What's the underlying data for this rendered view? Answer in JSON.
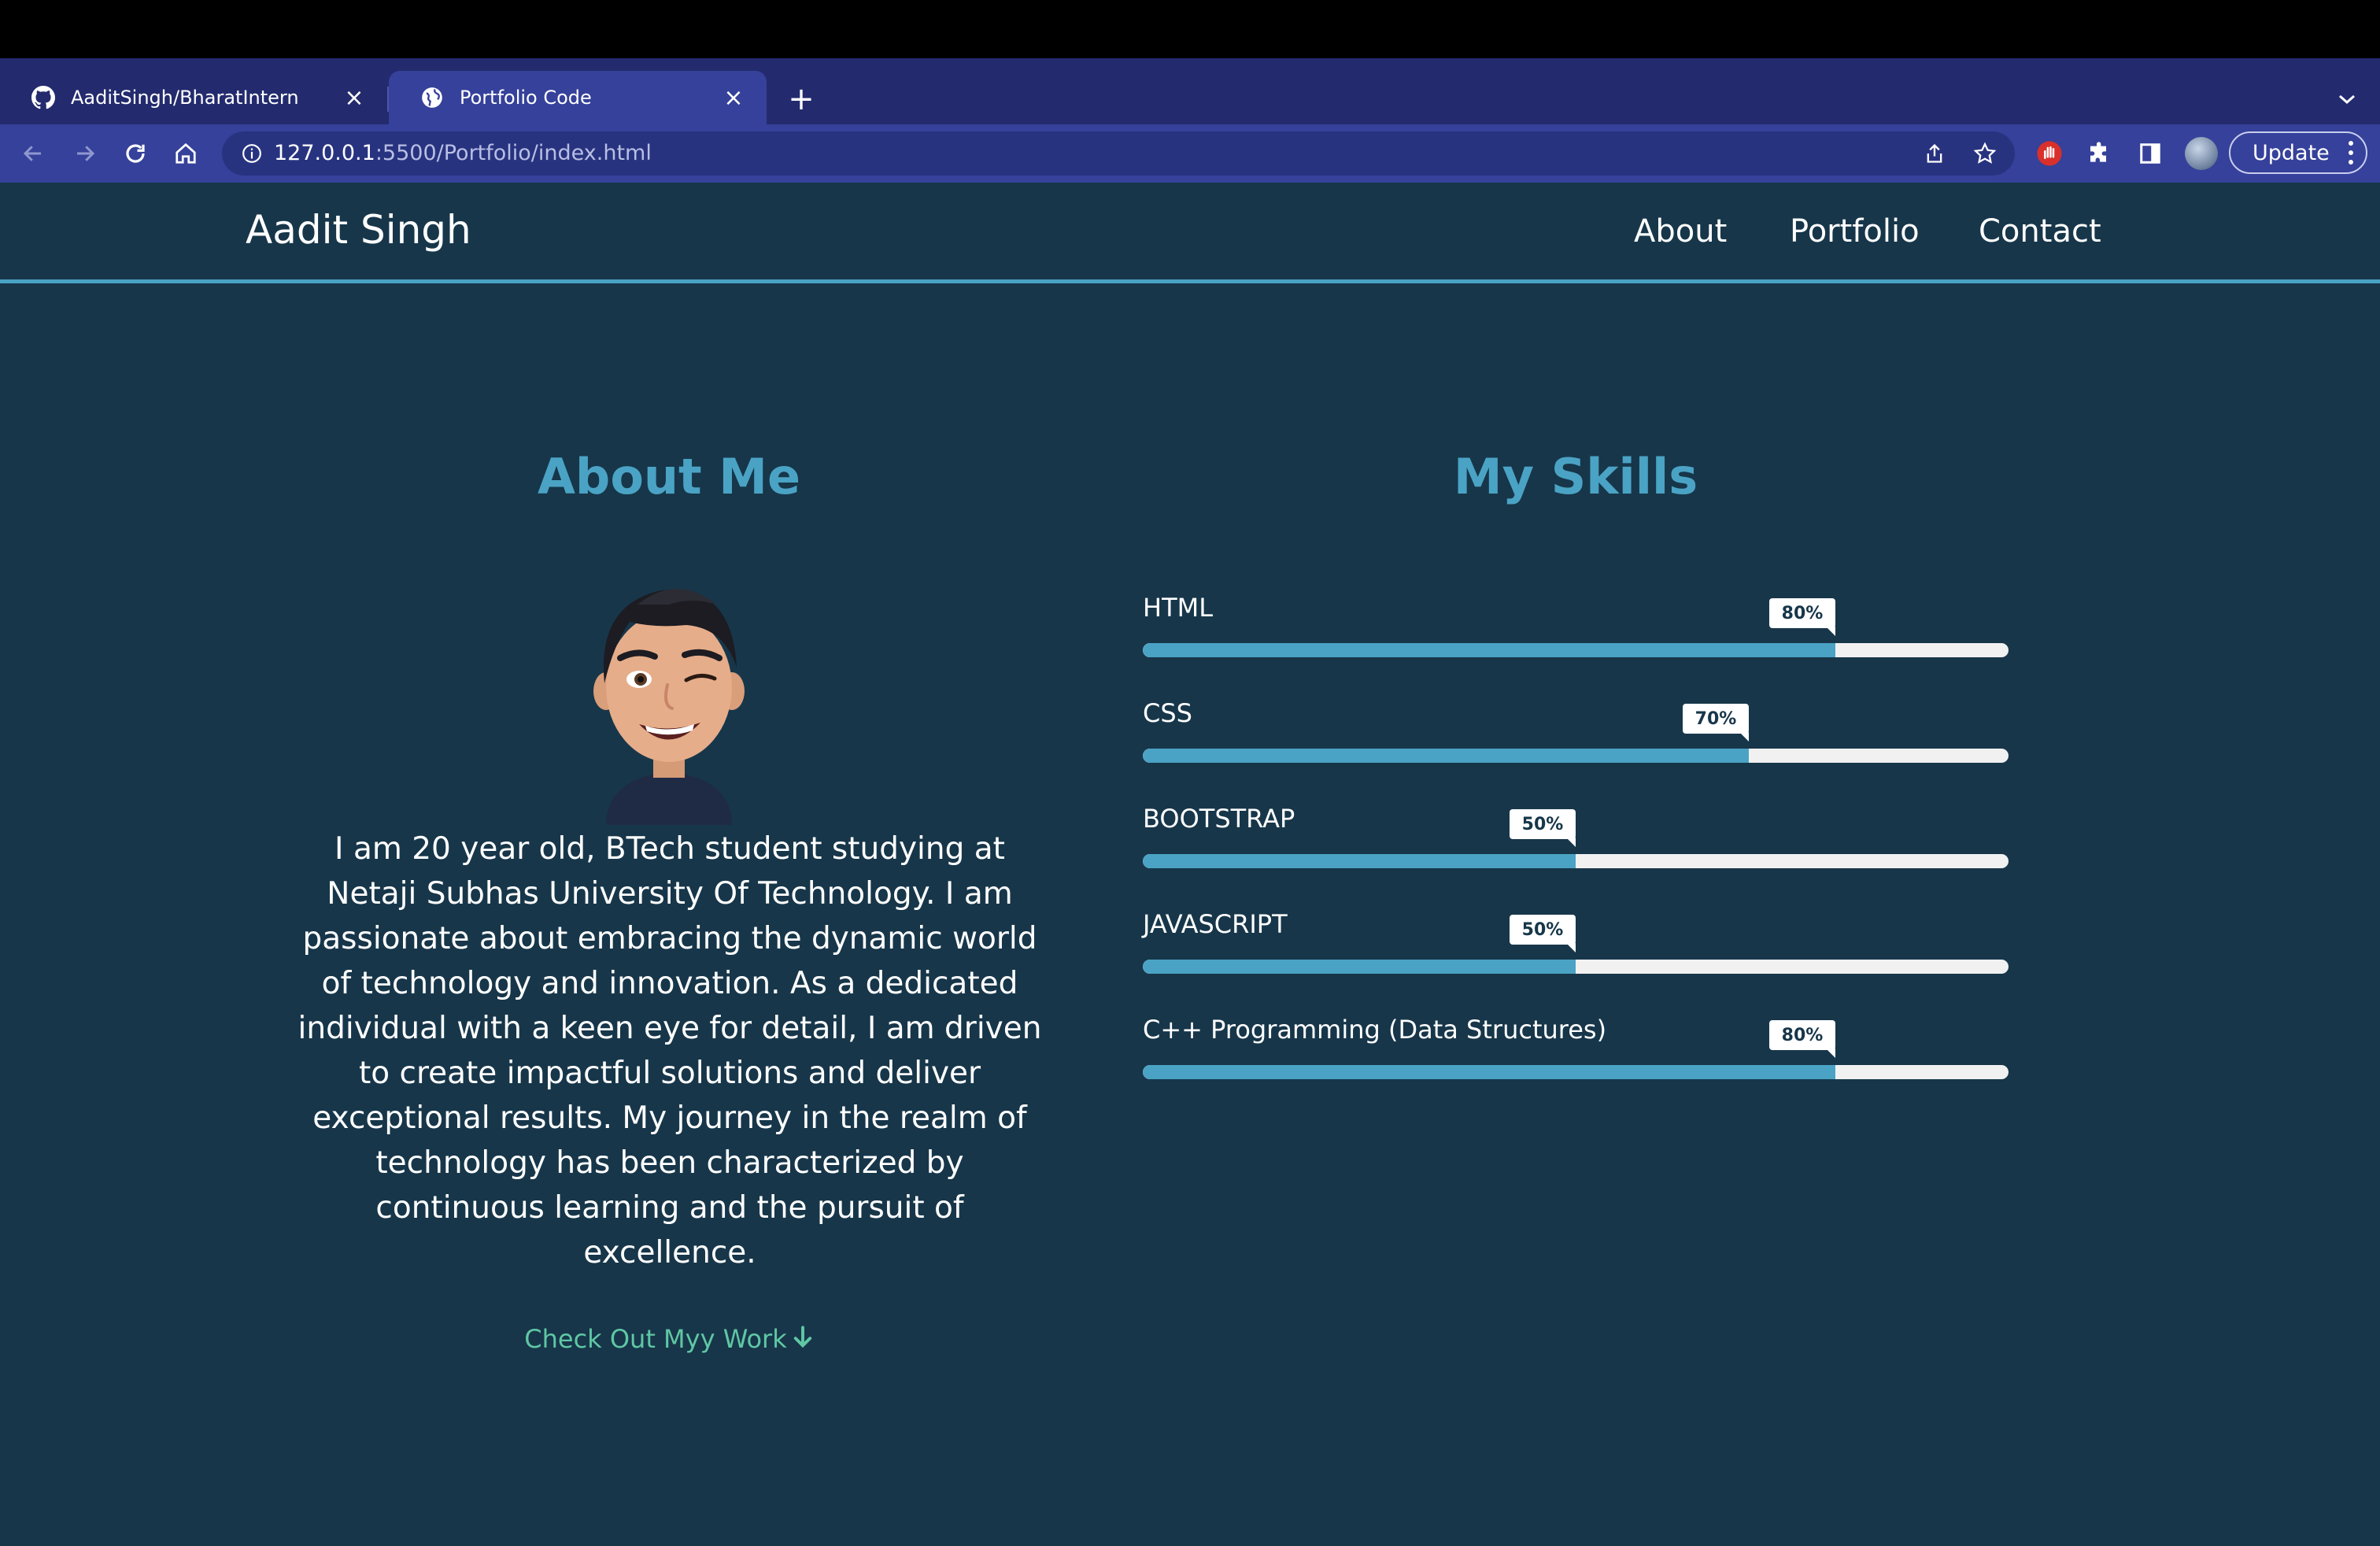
{
  "browser": {
    "tabs": [
      {
        "title": "AaditSingh/BharatIntern",
        "icon": "github-icon",
        "active": false
      },
      {
        "title": "Portfolio Code",
        "icon": "globe-icon",
        "active": true
      }
    ],
    "url_host": "127.0.0.1",
    "url_path": ":5500/Portfolio/index.html",
    "update_label": "Update"
  },
  "site": {
    "brand": "Aadit Singh",
    "nav": [
      "About",
      "Portfolio",
      "Contact"
    ]
  },
  "about": {
    "title": "About Me",
    "text": "I am 20 year old, BTech student studying at Netaji Subhas University Of Technology. I am passionate about embracing the dynamic world of technology and innovation. As a dedicated individual with a keen eye for detail, I am driven to create impactful solutions and deliver exceptional results. My journey in the realm of technology has been characterized by continuous learning and the pursuit of excellence.",
    "cta": "Check Out Myy Work"
  },
  "skills": {
    "title": "My Skills",
    "items": [
      {
        "name": "HTML",
        "label": "80%",
        "value": 80
      },
      {
        "name": "CSS",
        "label": "70%",
        "value": 70
      },
      {
        "name": "BOOTSTRAP",
        "label": "50%",
        "value": 50
      },
      {
        "name": "JAVASCRIPT",
        "label": "50%",
        "value": 50
      },
      {
        "name": "C++ Programming (Data Structures)",
        "label": "80%",
        "value": 80
      }
    ]
  },
  "colors": {
    "page_bg": "#17364a",
    "accent": "#4aa3c4",
    "cta": "#5fc7a4",
    "tabstrip": "#232b6e",
    "toolbar": "#35419a"
  }
}
